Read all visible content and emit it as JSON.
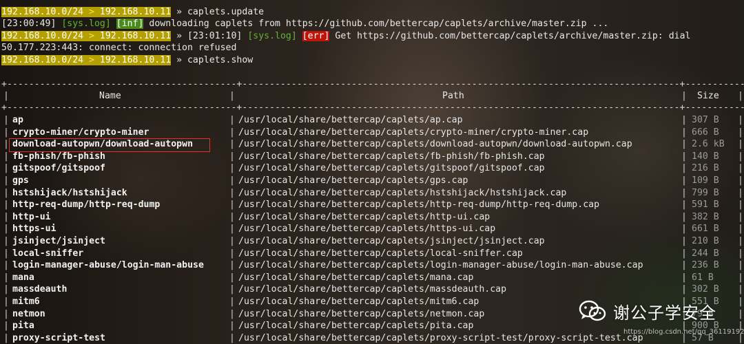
{
  "prompt": {
    "network": "192.168.10.0/24",
    "sep": " > ",
    "host": "192.168.10.11",
    "arrow": " » "
  },
  "log": {
    "line1_cmd": "caplets.update",
    "line2_time": "[23:00:49] ",
    "line2_syslog": "[sys.log]",
    "line2_level": "[inf]",
    "line2_msg": " downloading caplets from https://github.com/bettercap/caplets/archive/master.zip ...",
    "line3_time": "[23:01:10] ",
    "line3_syslog": "[sys.log]",
    "line3_level": "[err]",
    "line3_msg": " Get https://github.com/bettercap/caplets/archive/master.zip: dial",
    "line4": "50.177.223:443: connect: connection refused",
    "line5_cmd": "caplets.show"
  },
  "table": {
    "border": "+------------------------------------------+--------------------------------------------------------------------------------+-------------+",
    "headers": {
      "name": "Name",
      "path": "Path",
      "size": "Size"
    },
    "rows": [
      {
        "name": "ap",
        "path": "/usr/local/share/bettercap/caplets/ap.cap",
        "size": "307 B"
      },
      {
        "name": "crypto-miner/crypto-miner",
        "path": "/usr/local/share/bettercap/caplets/crypto-miner/crypto-miner.cap",
        "size": "666 B"
      },
      {
        "name": "download-autopwn/download-autopwn",
        "path": "/usr/local/share/bettercap/caplets/download-autopwn/download-autopwn.cap",
        "size": "2.6 kB"
      },
      {
        "name": "fb-phish/fb-phish",
        "path": "/usr/local/share/bettercap/caplets/fb-phish/fb-phish.cap",
        "size": "140 B"
      },
      {
        "name": "gitspoof/gitspoof",
        "path": "/usr/local/share/bettercap/caplets/gitspoof/gitspoof.cap",
        "size": "216 B"
      },
      {
        "name": "gps",
        "path": "/usr/local/share/bettercap/caplets/gps.cap",
        "size": "109 B"
      },
      {
        "name": "hstshijack/hstshijack",
        "path": "/usr/local/share/bettercap/caplets/hstshijack/hstshijack.cap",
        "size": "799 B"
      },
      {
        "name": "http-req-dump/http-req-dump",
        "path": "/usr/local/share/bettercap/caplets/http-req-dump/http-req-dump.cap",
        "size": "591 B"
      },
      {
        "name": "http-ui",
        "path": "/usr/local/share/bettercap/caplets/http-ui.cap",
        "size": "382 B"
      },
      {
        "name": "https-ui",
        "path": "/usr/local/share/bettercap/caplets/https-ui.cap",
        "size": "661 B"
      },
      {
        "name": "jsinject/jsinject",
        "path": "/usr/local/share/bettercap/caplets/jsinject/jsinject.cap",
        "size": "210 B"
      },
      {
        "name": "local-sniffer",
        "path": "/usr/local/share/bettercap/caplets/local-sniffer.cap",
        "size": "244 B"
      },
      {
        "name": "login-manager-abuse/login-man-abuse",
        "path": "/usr/local/share/bettercap/caplets/login-manager-abuse/login-man-abuse.cap",
        "size": "236 B"
      },
      {
        "name": "mana",
        "path": "/usr/local/share/bettercap/caplets/mana.cap",
        "size": "61 B"
      },
      {
        "name": "massdeauth",
        "path": "/usr/local/share/bettercap/caplets/massdeauth.cap",
        "size": "302 B"
      },
      {
        "name": "mitm6",
        "path": "/usr/local/share/bettercap/caplets/mitm6.cap",
        "size": "551 B"
      },
      {
        "name": "netmon",
        "path": "/usr/local/share/bettercap/caplets/netmon.cap",
        "size": "79 B"
      },
      {
        "name": "pita",
        "path": "/usr/local/share/bettercap/caplets/pita.cap",
        "size": "900 B"
      },
      {
        "name": "proxy-script-test",
        "path": "/usr/local/share/bettercap/caplets/proxy-script-test/proxy-script-test.cap",
        "size": "57 B"
      }
    ]
  },
  "watermark": {
    "text": "谢公子学安全",
    "icon": "wechat-icon",
    "url": "https://blog.csdn.net/qq_36119192"
  }
}
